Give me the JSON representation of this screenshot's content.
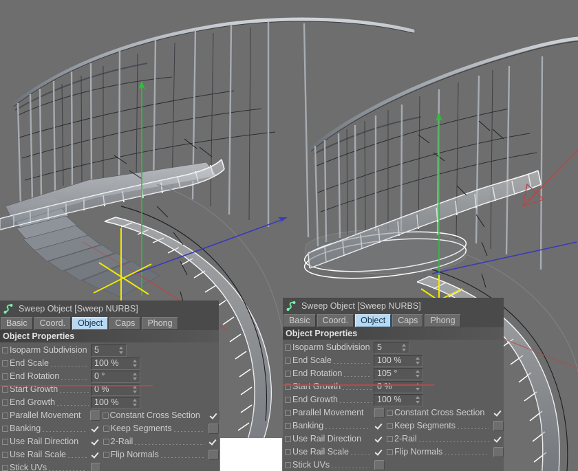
{
  "app": {
    "viewport_bg": "#6e6e6e",
    "panel_bg": "#5d5d5d",
    "accent_tab": "#b9d9f2",
    "axis_y_color": "#2fbf3a",
    "axis_x_color": "#b24a4a",
    "axis_z_color": "#3a3ab9",
    "gizmo_color": "#f2e800",
    "selection_color": "#ffffff"
  },
  "panels": [
    {
      "id": "left",
      "icon": "sweep-nurbs-icon",
      "title": "Sweep Object [Sweep NURBS]",
      "tabs": [
        {
          "label": "Basic",
          "active": false
        },
        {
          "label": "Coord.",
          "active": false
        },
        {
          "label": "Object",
          "active": true
        },
        {
          "label": "Caps",
          "active": false
        },
        {
          "label": "Phong",
          "active": false
        }
      ],
      "section": "Object Properties",
      "fields": [
        {
          "label": "Isoparm Subdivision",
          "value": "5",
          "leader": false
        },
        {
          "label": "End Scale",
          "value": "100 %",
          "leader": true
        },
        {
          "label": "End Rotation",
          "value": "0 °",
          "leader": true
        },
        {
          "label": "Start Growth",
          "value": "0 %",
          "leader": true
        },
        {
          "label": "End Growth",
          "value": "100 %",
          "leader": true
        }
      ],
      "checkboxes": [
        [
          {
            "label": "Parallel Movement",
            "checked": false,
            "leader": false
          },
          {
            "label": "Constant Cross Section",
            "checked": true,
            "leader": false
          }
        ],
        [
          {
            "label": "Banking",
            "checked": true,
            "leader": true
          },
          {
            "label": "Keep Segments",
            "checked": false,
            "leader": true
          }
        ],
        [
          {
            "label": "Use Rail Direction",
            "checked": true,
            "leader": false
          },
          {
            "label": "2-Rail",
            "checked": true,
            "leader": true
          }
        ],
        [
          {
            "label": "Use Rail Scale",
            "checked": true,
            "leader": true
          },
          {
            "label": "Flip Normals",
            "checked": false,
            "leader": true
          }
        ],
        [
          {
            "label": "Stick UVs",
            "checked": false,
            "leader": true
          },
          null
        ]
      ]
    },
    {
      "id": "right",
      "icon": "sweep-nurbs-icon",
      "title": "Sweep Object [Sweep NURBS]",
      "tabs": [
        {
          "label": "Basic",
          "active": false
        },
        {
          "label": "Coord.",
          "active": false
        },
        {
          "label": "Object",
          "active": true
        },
        {
          "label": "Caps",
          "active": false
        },
        {
          "label": "Phong",
          "active": false
        }
      ],
      "section": "Object Properties",
      "fields": [
        {
          "label": "Isoparm Subdivision",
          "value": "5",
          "leader": false
        },
        {
          "label": "End Scale",
          "value": "100 %",
          "leader": true
        },
        {
          "label": "End Rotation",
          "value": "105 °",
          "leader": true
        },
        {
          "label": "Start Growth",
          "value": "0 %",
          "leader": true
        },
        {
          "label": "End Growth",
          "value": "100 %",
          "leader": true
        }
      ],
      "checkboxes": [
        [
          {
            "label": "Parallel Movement",
            "checked": false,
            "leader": false
          },
          {
            "label": "Constant Cross Section",
            "checked": true,
            "leader": false
          }
        ],
        [
          {
            "label": "Banking",
            "checked": true,
            "leader": true
          },
          {
            "label": "Keep Segments",
            "checked": false,
            "leader": true
          }
        ],
        [
          {
            "label": "Use Rail Direction",
            "checked": true,
            "leader": false
          },
          {
            "label": "2-Rail",
            "checked": true,
            "leader": true
          }
        ],
        [
          {
            "label": "Use Rail Scale",
            "checked": true,
            "leader": true
          },
          {
            "label": "Flip Normals",
            "checked": false,
            "leader": true
          }
        ],
        [
          {
            "label": "Stick UVs",
            "checked": false,
            "leader": true
          },
          null
        ]
      ]
    }
  ],
  "scene": {
    "description": "Two 3D perspective viewports of a spiral staircase with curved handrail and balusters, a white-highlighted selected Sweep NURBS ramp/tread band, yellow object axis gizmo and coloured world axis lines."
  }
}
